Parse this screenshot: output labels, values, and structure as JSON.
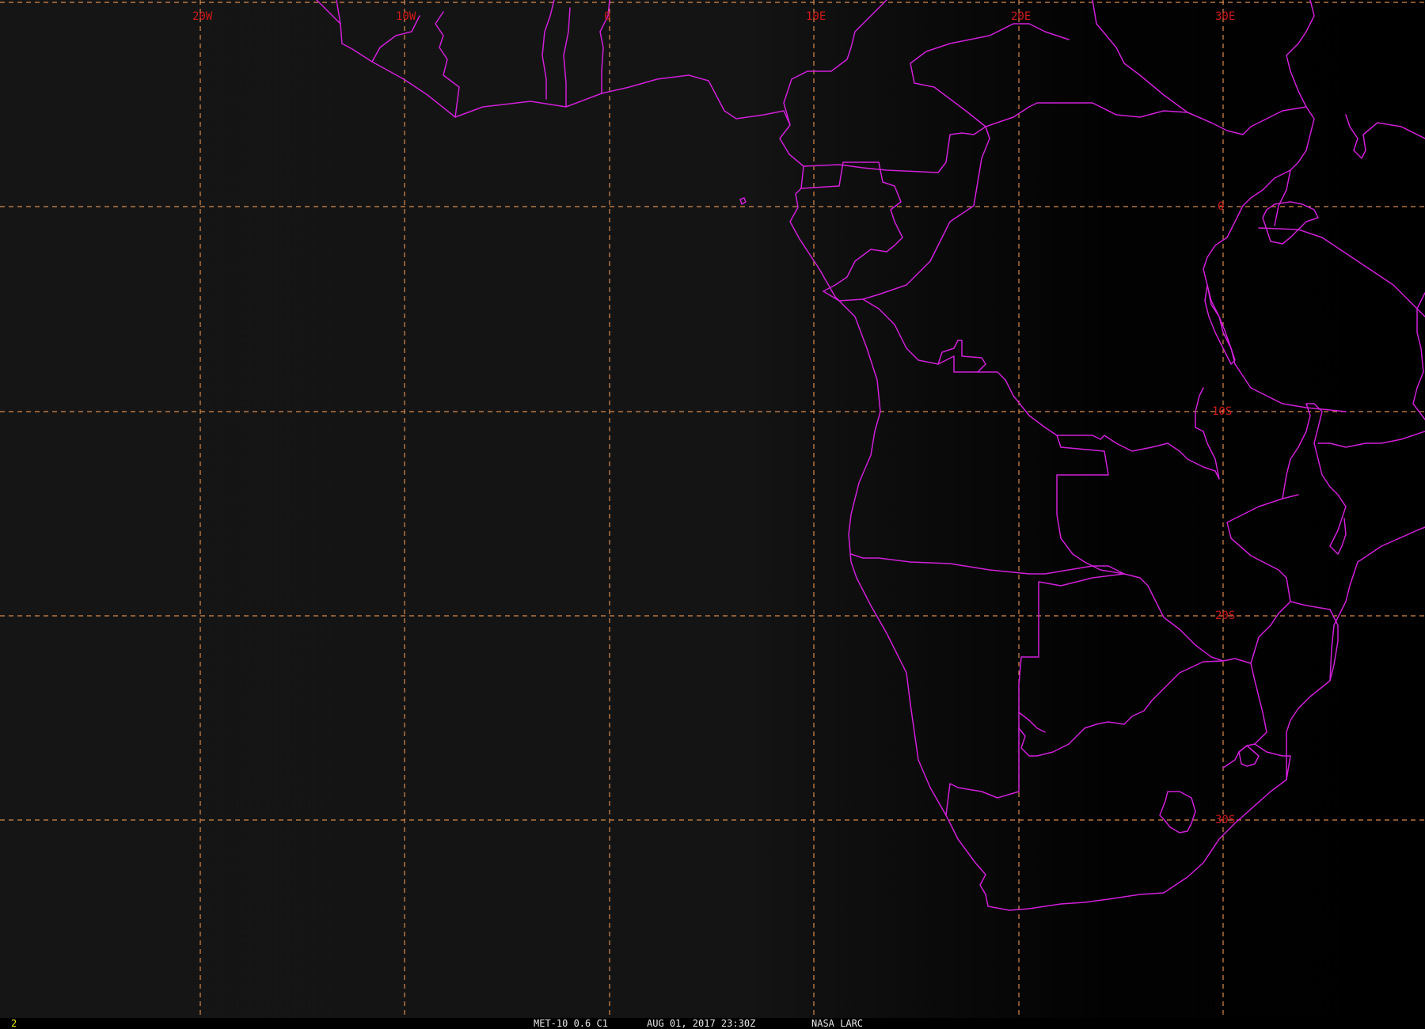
{
  "map": {
    "projection_grid": {
      "longitude_labels": [
        "20W",
        "10W",
        "0",
        "10E",
        "20E",
        "30E"
      ],
      "latitude_labels": [
        "0",
        "10S",
        "20S",
        "30S"
      ]
    },
    "colors": {
      "background_day": "#141414",
      "background_night": "#000000",
      "grid": "#d88a4e",
      "grid_label": "#cc1a1a",
      "borders": "#d020d8"
    }
  },
  "status": {
    "frame_number": "2",
    "satellite_channel": "MET-10 0.6 C1",
    "timestamp": "AUG 01, 2017 23:30Z",
    "agency": "NASA LARC"
  }
}
